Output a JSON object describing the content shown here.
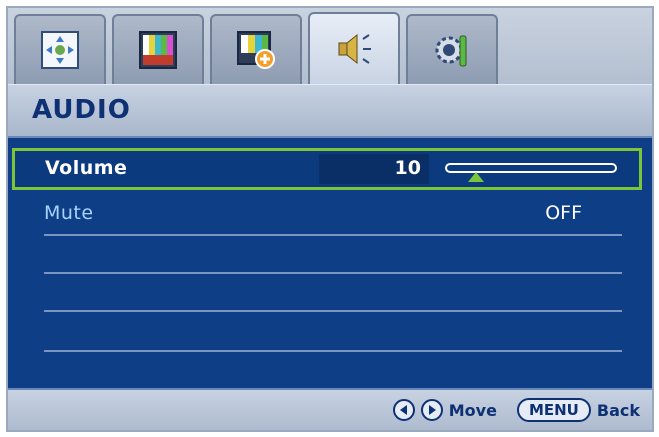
{
  "tabs": [
    {
      "icon": "picture-adjust-icon",
      "active": false
    },
    {
      "icon": "color-bars-icon",
      "active": false
    },
    {
      "icon": "picture-advanced-icon",
      "active": false
    },
    {
      "icon": "speaker-icon",
      "active": true
    },
    {
      "icon": "system-settings-icon",
      "active": false
    }
  ],
  "title": "AUDIO",
  "items": [
    {
      "label": "Volume",
      "value": "10",
      "slider_level": 0.1,
      "selected": true
    },
    {
      "label": "Mute",
      "value": "OFF",
      "selected": false
    }
  ],
  "footer": {
    "move_label": "Move",
    "menu_label": "MENU",
    "back_label": "Back"
  },
  "colors": {
    "background": "#0e3f86",
    "highlight": "#7cc43a",
    "header": "#c7d2e2",
    "title_text": "#0d3173"
  }
}
